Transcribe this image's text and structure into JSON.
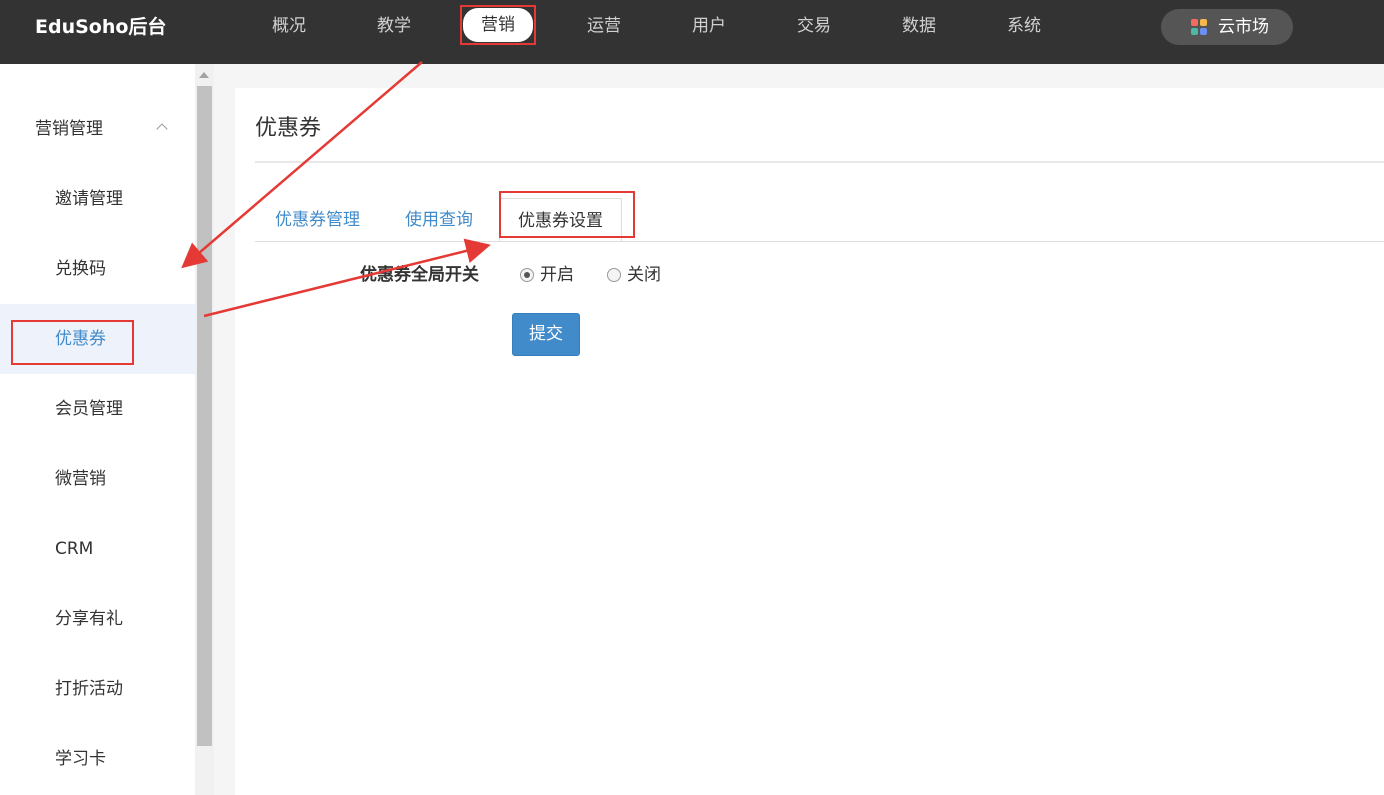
{
  "topbar": {
    "brand": "EduSoho后台",
    "nav": [
      "概况",
      "教学",
      "营销",
      "运营",
      "用户",
      "交易",
      "数据",
      "系统"
    ],
    "active_nav": "营销",
    "cloud_market": "云市场",
    "cloud_icon_colors": [
      "#f26b5b",
      "#f7b84b",
      "#4fb7a4",
      "#6b8ff2"
    ]
  },
  "sidebar": {
    "group_label": "营销管理",
    "items": [
      "邀请管理",
      "兑换码",
      "优惠券",
      "会员管理",
      "微营销",
      "CRM",
      "分享有礼",
      "打折活动",
      "学习卡"
    ],
    "active_item": "优惠券"
  },
  "main": {
    "title": "优惠券",
    "tabs": [
      "优惠券管理",
      "使用查询",
      "优惠券设置"
    ],
    "active_tab": "优惠券设置",
    "form": {
      "label": "优惠券全局开关",
      "options": [
        {
          "label": "开启",
          "checked": true
        },
        {
          "label": "关闭",
          "checked": false
        }
      ],
      "submit": "提交"
    }
  },
  "colors": {
    "topbar_bg": "#333333",
    "accent": "#428bca",
    "annotation_red": "#e53935"
  }
}
